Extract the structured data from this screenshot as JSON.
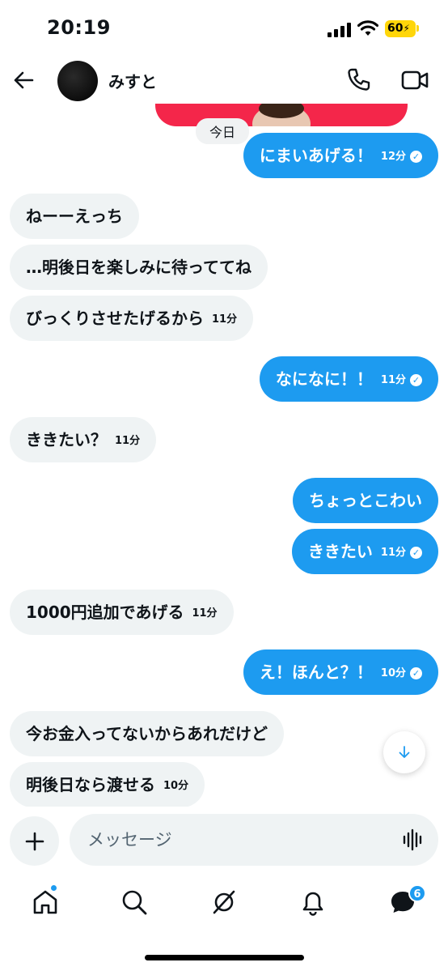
{
  "status_bar": {
    "time": "20:19",
    "battery": "60"
  },
  "header": {
    "contact_name": "みすと"
  },
  "chat": {
    "date_chip": "今日",
    "messages": [
      {
        "dir": "out",
        "text": "にまいあげる！",
        "time": "12分",
        "read": true
      },
      {
        "dir": "in",
        "text": "ねーーえっち",
        "time": ""
      },
      {
        "dir": "in",
        "text": "…明後日を楽しみに待っててね",
        "time": ""
      },
      {
        "dir": "in",
        "text": "びっくりさせたげるから",
        "time": "11分"
      },
      {
        "dir": "out",
        "text": "なになに！！",
        "time": "11分",
        "read": true
      },
      {
        "dir": "in",
        "text": "ききたい？",
        "time": "11分"
      },
      {
        "dir": "out",
        "text": "ちょっとこわい",
        "time": ""
      },
      {
        "dir": "out",
        "text": "ききたい",
        "time": "11分",
        "read": true
      },
      {
        "dir": "in",
        "text": "1000円追加であげる",
        "time": "11分"
      },
      {
        "dir": "out",
        "text": "え！ほんと？！",
        "time": "10分",
        "read": true
      },
      {
        "dir": "in",
        "text": "今お金入ってないからあれだけど",
        "time": ""
      },
      {
        "dir": "in",
        "text": "明後日なら渡せる",
        "time": "10分"
      }
    ]
  },
  "composer": {
    "placeholder": "メッセージ"
  },
  "tabbar": {
    "messages_badge": "6"
  },
  "colors": {
    "accent": "#1d9bf0",
    "incoming_bubble": "#eff3f4",
    "card": "#f4264a"
  },
  "icons": [
    "back-arrow-icon",
    "phone-icon",
    "video-camera-icon",
    "plus-icon",
    "voice-wave-icon",
    "arrow-down-icon",
    "home-icon",
    "search-icon",
    "grok-icon",
    "bell-icon",
    "messages-icon"
  ]
}
